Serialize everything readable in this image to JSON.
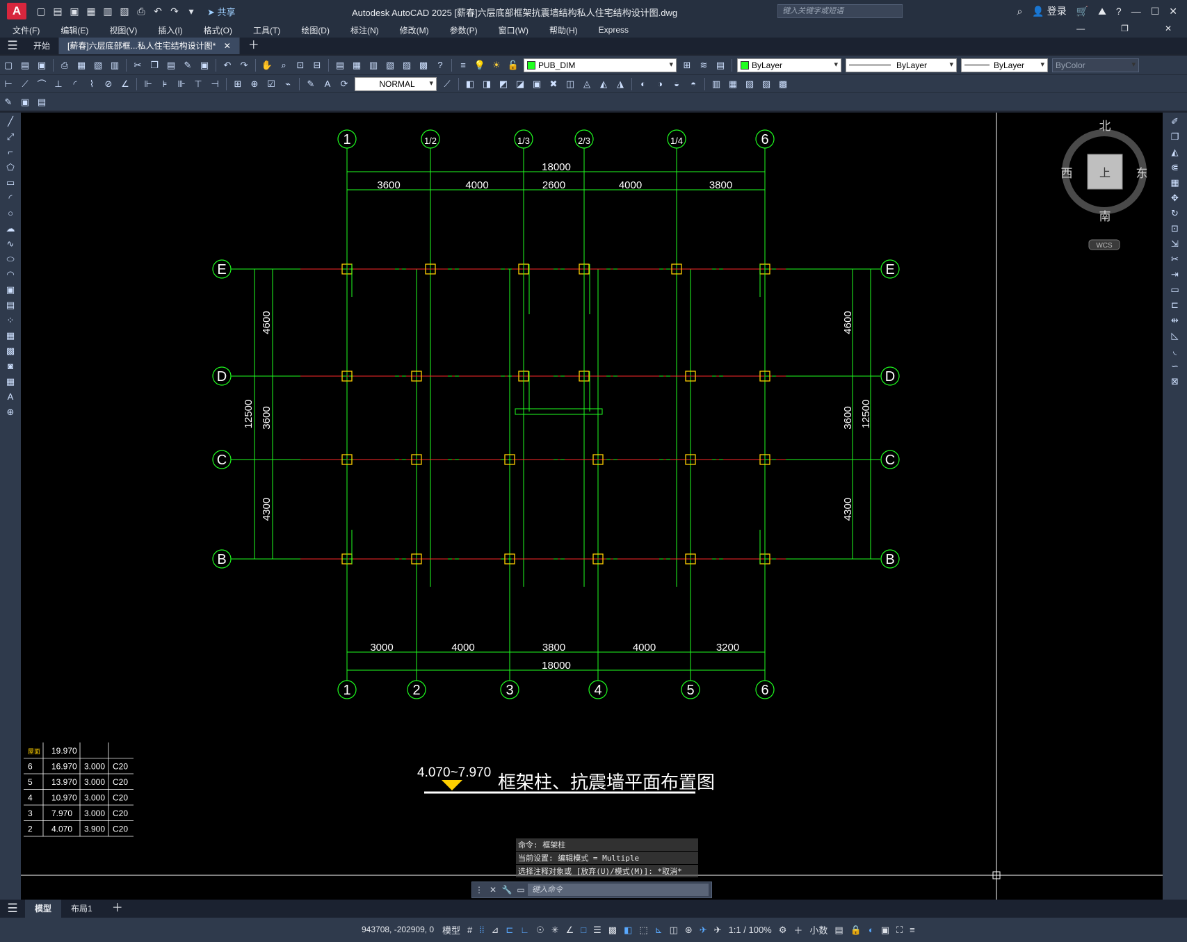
{
  "app": {
    "logo": "A",
    "title": "Autodesk AutoCAD 2025    [薪春]六层底部框架抗震墙结构私人住宅结构设计图.dwg",
    "share_label": "共享",
    "search_placeholder": "键入关键字或短语",
    "login_label": "登录"
  },
  "menu": [
    "文件(F)",
    "编辑(E)",
    "视图(V)",
    "插入(I)",
    "格式(O)",
    "工具(T)",
    "绘图(D)",
    "标注(N)",
    "修改(M)",
    "参数(P)",
    "窗口(W)",
    "帮助(H)",
    "Express"
  ],
  "doc_tabs": [
    {
      "label": "开始"
    },
    {
      "label": "[薪春]六层底部框...私人住宅结构设计图*"
    }
  ],
  "toolbar": {
    "layer_name": "PUB_DIM",
    "color": "ByLayer",
    "linetype": "ByLayer",
    "lineweight": "ByLayer",
    "plotstyle": "ByColor",
    "dimstyle": "NORMAL"
  },
  "viewcube": {
    "north": "北",
    "south": "南",
    "east": "东",
    "west": "西",
    "top": "上",
    "wcs": "WCS"
  },
  "drawing": {
    "title_prefix": "4.070~7.970",
    "title": "框架柱、抗震墙平面布置图",
    "top_axes": [
      "1",
      "1/2",
      "1/3",
      "2/3",
      "1/4",
      "6"
    ],
    "bottom_axes": [
      "1",
      "2",
      "3",
      "4",
      "5",
      "6"
    ],
    "row_axes": [
      "E",
      "D",
      "C",
      "B"
    ],
    "top_total": "18000",
    "top_spans": [
      "3600",
      "4000",
      "2600",
      "4000",
      "3800"
    ],
    "bottom_total": "18000",
    "bottom_spans": [
      "3000",
      "4000",
      "3800",
      "4000",
      "3200"
    ],
    "left_total": "12500",
    "left_spans": [
      "4600",
      "3600",
      "4300"
    ],
    "right_total": "12500",
    "right_spans": [
      "4600",
      "3600",
      "4300"
    ]
  },
  "elevation_table": [
    {
      "floor": "屋面",
      "elev": "19.970",
      "height": "",
      "concrete": ""
    },
    {
      "floor": "6",
      "elev": "16.970",
      "height": "3.000",
      "concrete": "C20"
    },
    {
      "floor": "5",
      "elev": "13.970",
      "height": "3.000",
      "concrete": "C20"
    },
    {
      "floor": "4",
      "elev": "10.970",
      "height": "3.000",
      "concrete": "C20"
    },
    {
      "floor": "3",
      "elev": "7.970",
      "height": "3.000",
      "concrete": "C20"
    },
    {
      "floor": "2",
      "elev": "4.070",
      "height": "3.900",
      "concrete": "C20"
    }
  ],
  "command": {
    "history": [
      "命令: 框架柱",
      "当前设置: 编辑模式 = Multiple",
      "选择注释对象或 [放弃(U)/模式(M)]: *取消*"
    ],
    "placeholder": "键入命令"
  },
  "layout_tabs": [
    "模型",
    "布局1"
  ],
  "status": {
    "coords": "943708, -202909, 0",
    "model": "模型",
    "scale": "1:1 / 100%",
    "units": "小数"
  }
}
